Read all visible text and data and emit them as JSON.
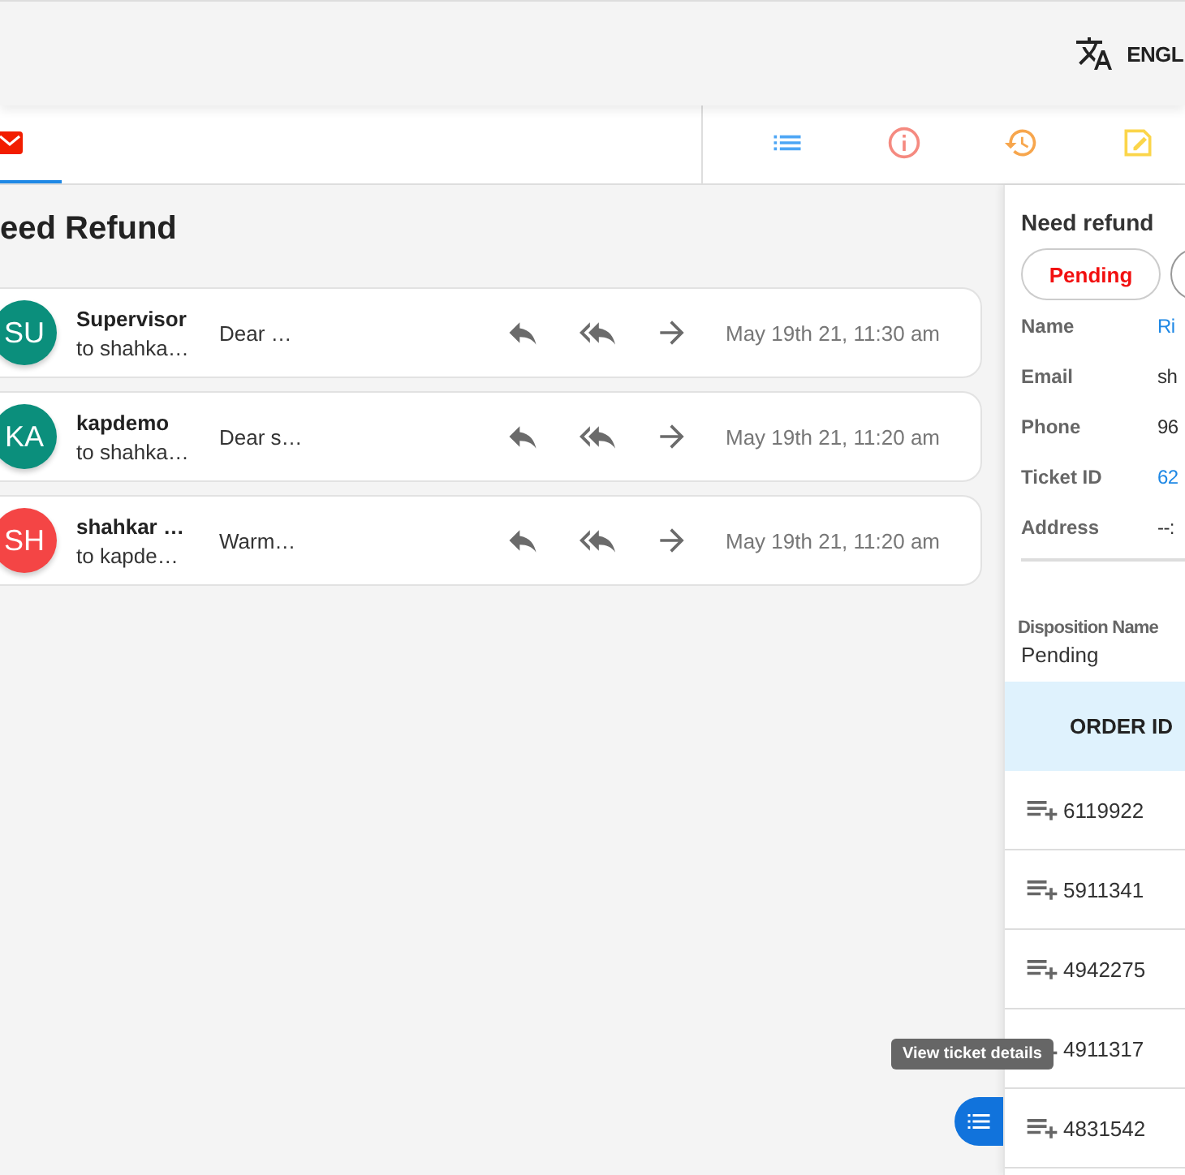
{
  "header": {
    "language": "ENGL"
  },
  "left_tabs": [
    {
      "kind": "mail",
      "selected": true
    }
  ],
  "panel_tabs": [
    {
      "kind": "list",
      "selected": false
    },
    {
      "kind": "info",
      "selected": false
    },
    {
      "kind": "history",
      "selected": false
    },
    {
      "kind": "note",
      "selected": false
    }
  ],
  "thread": {
    "title": "eed Refund",
    "messages": [
      {
        "initials": "SU",
        "color": "#0b8f7c",
        "sender": "Supervisor",
        "to": "to shahka…",
        "preview": "Dear …",
        "time": "May 19th 21, 11:30 am"
      },
      {
        "initials": "KA",
        "color": "#0b8f7c",
        "sender": "kapdemo",
        "to": "to shahka…",
        "preview": "Dear s…",
        "time": "May 19th 21, 11:20 am"
      },
      {
        "initials": "SH",
        "color": "#f44545",
        "sender": "shahkar …",
        "to": "to kapde…",
        "preview": "Warm…",
        "time": "May 19th 21, 11:20 am"
      }
    ]
  },
  "details": {
    "title": "Need refund",
    "status_buttons": [
      {
        "label": "Pending",
        "selected": true
      },
      {
        "selected": false
      }
    ],
    "fields": [
      {
        "label": "Name",
        "value": "Ri",
        "kind": "link"
      },
      {
        "label": "Email",
        "value": "sh",
        "kind": "text"
      },
      {
        "label": "Phone",
        "value": "96",
        "kind": "text"
      },
      {
        "label": "Ticket ID",
        "value": "62",
        "kind": "link"
      },
      {
        "label": "Address",
        "value": "--:",
        "kind": "text"
      }
    ],
    "disposition": {
      "label": "Disposition Name",
      "value": "Pending"
    }
  },
  "orders": {
    "columns": [
      "ORDER ID"
    ],
    "rows": [
      "6119922",
      "5911341",
      "4942275",
      "4911317",
      "4831542"
    ]
  },
  "tooltip": "View ticket details"
}
